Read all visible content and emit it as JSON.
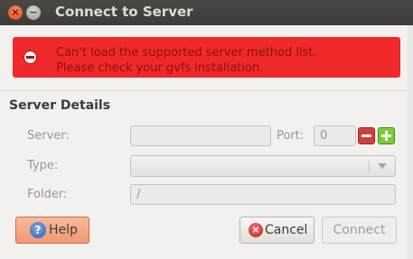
{
  "window": {
    "title": "Connect to Server",
    "close_glyph": "×",
    "minimize_glyph": "−"
  },
  "error": {
    "line1": "Can't load the supported server method list.",
    "line2": "Please check your gvfs installation."
  },
  "section": {
    "title": "Server Details"
  },
  "fields": {
    "server_label": "Server:",
    "server_value": "",
    "port_label": "Port:",
    "port_value": "0",
    "type_label": "Type:",
    "type_value": "",
    "folder_label": "Folder:",
    "folder_value": "/"
  },
  "buttons": {
    "help": "Help",
    "help_glyph": "?",
    "cancel": "Cancel",
    "cancel_glyph": "×",
    "connect": "Connect"
  },
  "colors": {
    "error_background": "#ef2929",
    "error_text": "#8f1010",
    "help_button": "#ee9a73",
    "titlebar": "#3c3b37"
  }
}
